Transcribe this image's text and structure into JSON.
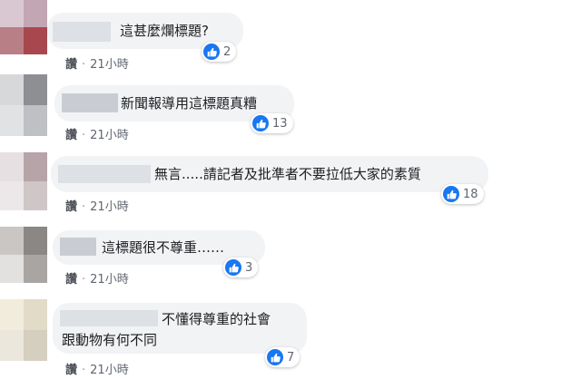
{
  "colors": {
    "like_blue": "#1877f2",
    "bubble": "#f2f3f5",
    "meta": "#606770"
  },
  "comments": [
    {
      "text": "這甚麼爛標題?",
      "likes": "2",
      "action": "讚",
      "separator": "·",
      "time": "21小時",
      "react_icon": "thumbs-up-icon"
    },
    {
      "text": "新聞報導用這標題真糟",
      "likes": "13",
      "action": "讚",
      "separator": "·",
      "time": "21小時",
      "react_icon": "thumbs-up-icon"
    },
    {
      "text": "無言.....請記者及批準者不要拉低大家的素質",
      "likes": "18",
      "action": "讚",
      "separator": "·",
      "time": "21小時",
      "react_icon": "thumbs-up-icon"
    },
    {
      "text": "這標題很不尊重……",
      "likes": "3",
      "action": "讚",
      "separator": "·",
      "time": "21小時",
      "react_icon": "thumbs-up-icon"
    },
    {
      "text": "不懂得尊重的社會",
      "text_line2": "跟動物有何不同",
      "likes": "7",
      "action": "讚",
      "separator": "·",
      "time": "21小時",
      "react_icon": "thumbs-up-icon"
    }
  ]
}
